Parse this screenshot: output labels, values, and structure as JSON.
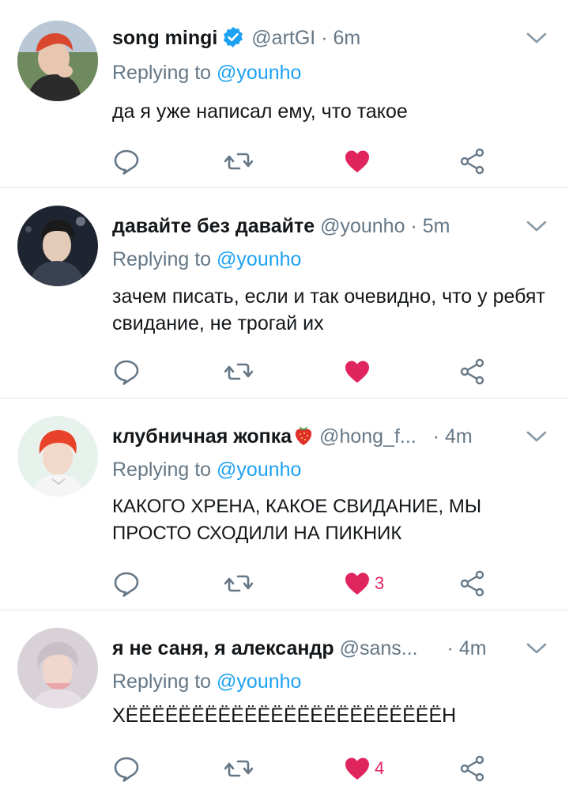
{
  "colors": {
    "like": "#e0245e",
    "icon": "#657786",
    "link": "#1da1f2",
    "verified": "#1da1f2"
  },
  "tweets": [
    {
      "name": "song mingi",
      "verified": true,
      "handle": "@artGI",
      "time": "· 6m",
      "reply_prefix": "Replying to",
      "reply_mention": "@younho",
      "text": "да я уже написал ему, что такое",
      "like_count": ""
    },
    {
      "name": "давайте без давайте",
      "verified": false,
      "handle": "@younho",
      "time": "· 5m",
      "reply_prefix": "Replying to",
      "reply_mention": "@younho",
      "text": "зачем писать, если и так очевидно, что у ребят свидание, не трогай их",
      "like_count": ""
    },
    {
      "name": "клубничная жопка",
      "emoji": "strawberry-icon",
      "verified": false,
      "handle": "@hong_f...",
      "time": "· 4m",
      "reply_prefix": "Replying to",
      "reply_mention": "@younho",
      "text": "КАКОГО ХРЕНА, КАКОЕ СВИДАНИЕ, МЫ ПРОСТО СХОДИЛИ НА ПИКНИК",
      "like_count": "3"
    },
    {
      "name": "я не саня, я александр",
      "verified": false,
      "handle": "@sans...",
      "time": "· 4m",
      "reply_prefix": "Replying to",
      "reply_mention": "@younho",
      "text": "ХЁЁЁЁЁЁЁЁЁЁЁЁЁЁЁЁЁЁЁЁЁЁЁЁН",
      "like_count": "4"
    }
  ]
}
